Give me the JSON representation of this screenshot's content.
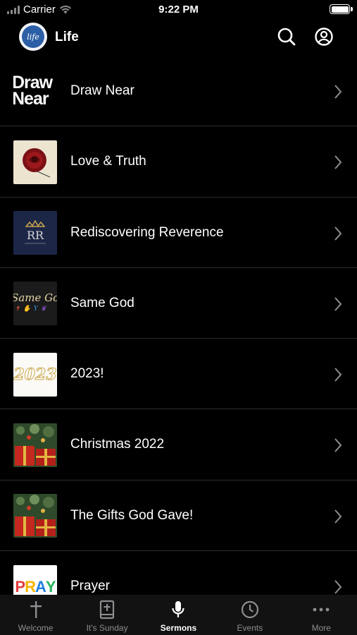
{
  "status_bar": {
    "carrier": "Carrier",
    "time": "9:22 PM"
  },
  "header": {
    "logo_text": "life",
    "title": "Life"
  },
  "series": [
    {
      "label": "Draw Near",
      "thumb_text": [
        "Draw",
        "Near"
      ]
    },
    {
      "label": "Love & Truth"
    },
    {
      "label": "Rediscovering Reverence",
      "thumb_text": "RR"
    },
    {
      "label": "Same God",
      "thumb_text": "Same Go"
    },
    {
      "label": "2023!",
      "thumb_text": "2023"
    },
    {
      "label": "Christmas 2022"
    },
    {
      "label": "The Gifts God Gave!"
    },
    {
      "label": "Prayer",
      "thumb_text": [
        "P",
        "R",
        "A",
        "Y"
      ]
    }
  ],
  "tabs": [
    {
      "label": "Welcome",
      "icon": "cross-icon"
    },
    {
      "label": "It's Sunday",
      "icon": "bible-icon"
    },
    {
      "label": "Sermons",
      "icon": "microphone-icon",
      "active": true
    },
    {
      "label": "Events",
      "icon": "clock-icon"
    },
    {
      "label": "More",
      "icon": "more-dots-icon"
    }
  ],
  "colors": {
    "background": "#000000",
    "tab_bar": "#121212",
    "inactive_tab": "#8e8e93",
    "separator": "#2c2c2e"
  }
}
